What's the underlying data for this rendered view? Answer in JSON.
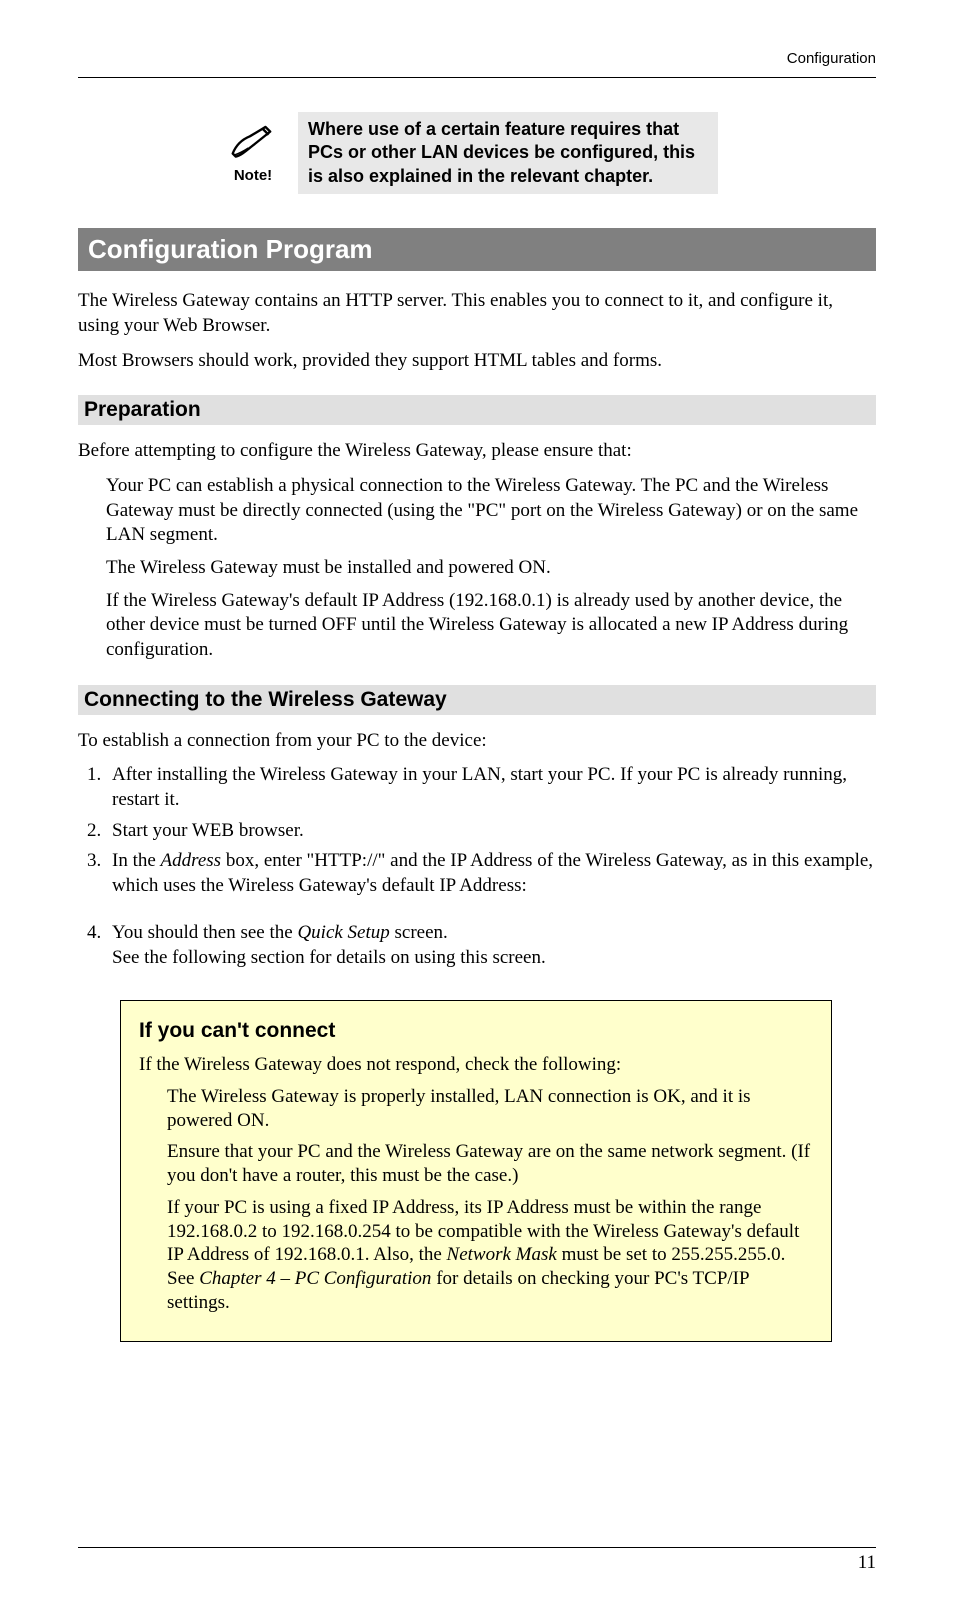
{
  "header": {
    "right_text": "Configuration"
  },
  "note": {
    "label": "Note!",
    "text": "Where use of a certain feature requires that PCs or other LAN devices be configured, this is also explained in the relevant chapter."
  },
  "section": {
    "title": "Configuration Program"
  },
  "intro_p1": "The Wireless Gateway contains an HTTP server. This enables you to connect to it, and configure it, using your Web Browser.",
  "intro_p2": "Most Browsers should work, provided they support HTML tables and forms.",
  "preparation": {
    "title": "Preparation",
    "lead": "Before attempting to configure the Wireless Gateway, please ensure that:",
    "items": [
      "Your PC can establish a physical connection to the Wireless Gateway. The PC and the Wireless Gateway must be directly connected (using the \"PC\" port on the Wireless Gateway) or on the same LAN segment.",
      "The Wireless Gateway must be installed and powered ON.",
      "If the Wireless Gateway's default IP Address (192.168.0.1) is already used by another device, the other device must be turned OFF until the Wireless Gateway is allocated a new IP Address during configuration."
    ]
  },
  "connecting": {
    "title": "Connecting to the Wireless Gateway",
    "lead": "To establish a connection from your PC to the device:",
    "steps": {
      "s1": "After installing the Wireless Gateway in your LAN, start your PC. If your PC is already running, restart it.",
      "s2": "Start your WEB browser.",
      "s3_pre": "In the ",
      "s3_address": "Address",
      "s3_post": " box, enter \"HTTP://\" and the IP Address of the Wireless Gateway, as in this example, which uses the Wireless Gateway's default IP Address:",
      "s4_pre": "You should then see the ",
      "s4_quick": "Quick Setup",
      "s4_post": " screen.",
      "s4_line2": "See the following section for details on using this screen."
    }
  },
  "callout": {
    "title": "If you can't connect",
    "lead": "If the Wireless Gateway does not respond, check the following:",
    "b1": "The Wireless Gateway is properly installed, LAN connection is OK, and it is powered ON.",
    "b2": "Ensure that your PC and the Wireless Gateway are on the same network segment. (If you don't have a router, this must be the case.)",
    "b3_pre": "If your PC is using a fixed IP Address, its IP Address must be within the range 192.168.0.2 to 192.168.0.254 to be compatible with the Wireless Gateway's default IP Address of 192.168.0.1. Also, the ",
    "b3_netmask": "Network Mask",
    "b3_mid": " must be set to 255.255.255.0. See ",
    "b3_chap": "Chapter 4 – PC Configuration",
    "b3_post": " for details on checking your PC's TCP/IP settings."
  },
  "page_number": "11"
}
